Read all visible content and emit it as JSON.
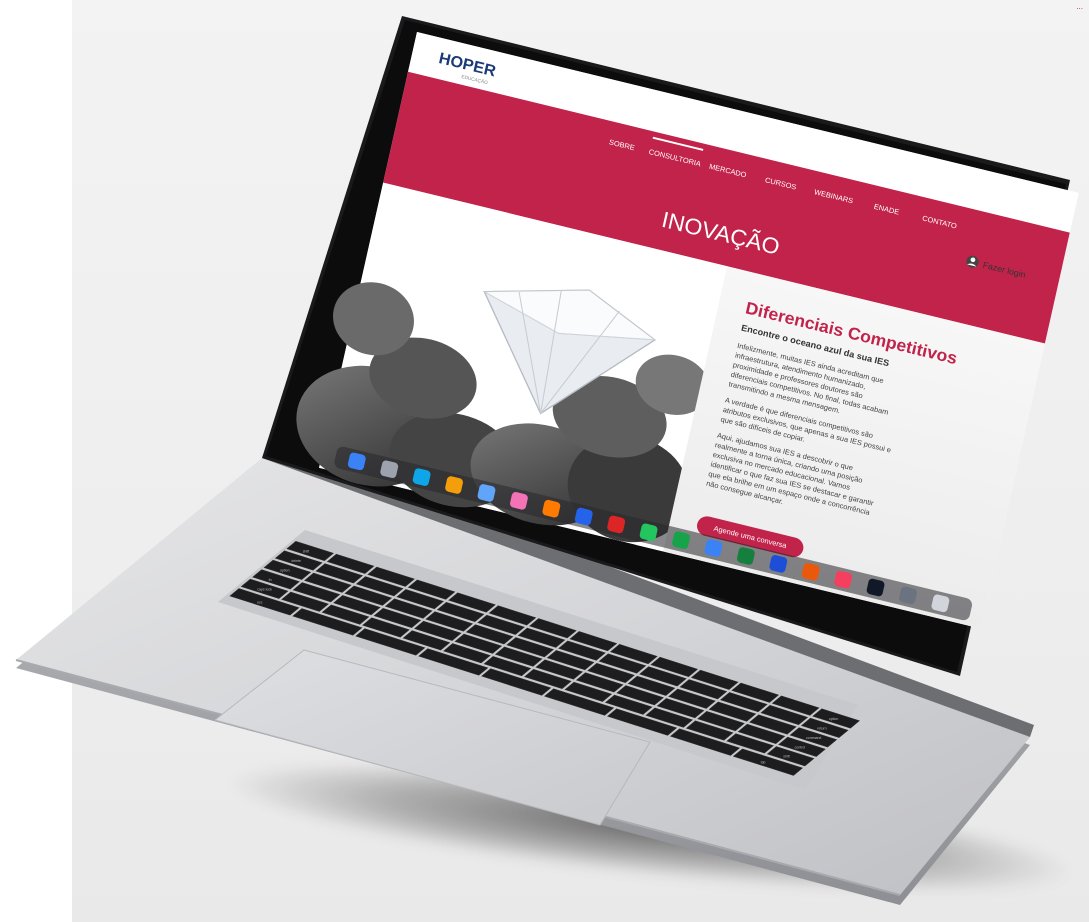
{
  "site": {
    "logo_text": "HOPER",
    "logo_sub": "EDUCAÇÃO",
    "nav": [
      "SOBRE",
      "CONSULTORIA",
      "MERCADO",
      "CURSOS",
      "WEBINARS",
      "ENADE",
      "CONTATO"
    ],
    "active_nav": "CONSULTORIA",
    "login_label": "Fazer login",
    "banner_title": "INOVAÇÃO",
    "heading": "Diferenciais Competitivos",
    "subheading": "Encontre o oceano azul da sua IES",
    "paragraph1": [
      "Infelizmente, muitas IES ainda acreditam que",
      "infraestrutura, atendimento humanizado,",
      "proximidade e professores doutores são",
      "diferenciais competitivos. No final, todas acabam",
      "transmitindo a mesma mensagem."
    ],
    "paragraph2": [
      "A verdade é que diferenciais competitivos são",
      "atributos exclusivos, que apenas a sua IES possui e",
      "que são difíceis de copiar."
    ],
    "paragraph3": [
      "Aqui, ajudamos sua IES a descobrir o que",
      "realmente a torna única, criando uma posição",
      "exclusiva no mercado educacional. Vamos",
      "identificar o que faz sua IES se destacar e garantir",
      "que ela brilhe em um espaço onde a concorrência",
      "não consegue alcançar."
    ],
    "cta_label": "Agende uma conversa"
  },
  "colors": {
    "brand_red": "#c1234b",
    "logo_blue": "#1b3a78",
    "text_dark": "#333333",
    "page_bg": "#efefef"
  },
  "keyboard": {
    "key_labels": [
      "esc",
      "tab",
      "caps lock",
      "shift",
      "fn",
      "control",
      "option",
      "command",
      "delete",
      "return",
      "shift",
      "option",
      "command"
    ]
  },
  "dock": {
    "icons": [
      "finder-icon",
      "launchpad-icon",
      "safari-icon",
      "chrome-icon",
      "mail-icon",
      "photos-icon",
      "illustrator-icon",
      "photoshop-icon",
      "acrobat-icon",
      "whatsapp-icon",
      "spotify-icon",
      "zoom-icon",
      "excel-icon",
      "word-icon",
      "powerpoint-icon",
      "music-icon",
      "appletv-icon",
      "settings-icon",
      "trash-icon"
    ]
  },
  "corner_text": "..."
}
